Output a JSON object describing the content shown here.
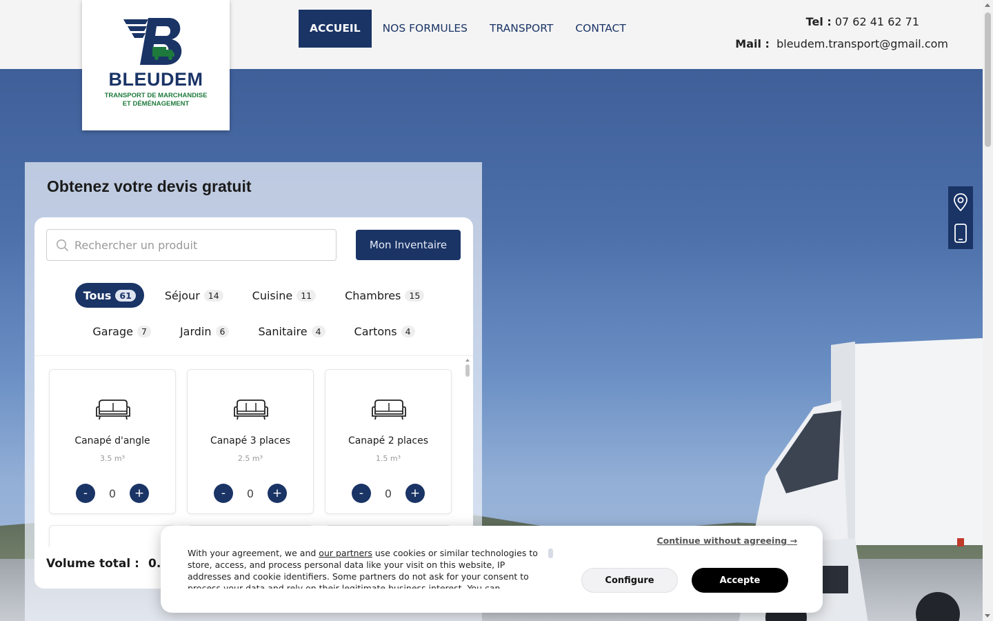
{
  "brand": {
    "name": "BLEUDEM",
    "tagline_line1": "TRANSPORT DE MARCHANDISE",
    "tagline_line2": "ET DÉMÉNAGEMENT",
    "primary_color": "#1a3466",
    "accent_color": "#1e7a3c"
  },
  "nav": {
    "items": [
      {
        "label": "ACCUEIL",
        "active": true
      },
      {
        "label": "NOS FORMULES",
        "active": false
      },
      {
        "label": "TRANSPORT",
        "active": false
      },
      {
        "label": "CONTACT",
        "active": false
      }
    ]
  },
  "contact": {
    "tel_label": "Tel :",
    "tel_value": "07 62 41 62 71",
    "mail_label": "Mail :",
    "mail_value": "bleudem.transport@gmail.com"
  },
  "side_icons": [
    "location-pin-icon",
    "smartphone-icon"
  ],
  "quote": {
    "title": "Obtenez votre devis gratuit",
    "search_placeholder": "Rechercher un produit",
    "inventory_button": "Mon Inventaire",
    "categories_row1": [
      {
        "label": "Tous",
        "count": "61",
        "active": true
      },
      {
        "label": "Séjour",
        "count": "14"
      },
      {
        "label": "Cuisine",
        "count": "11"
      },
      {
        "label": "Chambres",
        "count": "15"
      }
    ],
    "categories_row2": [
      {
        "label": "Garage",
        "count": "7"
      },
      {
        "label": "Jardin",
        "count": "6"
      },
      {
        "label": "Sanitaire",
        "count": "4"
      },
      {
        "label": "Cartons",
        "count": "4"
      }
    ],
    "products": [
      {
        "name": "Canapé d'angle",
        "volume": "3.5 m³",
        "qty": "0",
        "icon": "sofa-icon"
      },
      {
        "name": "Canapé 3 places",
        "volume": "2.5 m³",
        "qty": "0",
        "icon": "sofa-icon"
      },
      {
        "name": "Canapé 2 places",
        "volume": "1.5 m³",
        "qty": "0",
        "icon": "sofa-icon"
      }
    ],
    "minus_label": "-",
    "plus_label": "+",
    "volume_label": "Volume total :",
    "volume_value": "0."
  },
  "cookie": {
    "text_before_link": "With your agreement, we and ",
    "link_text": "our partners",
    "text_after_link": " use cookies or similar technologies to store, access, and process personal data like your visit on this website, IP addresses and cookie identifiers. Some partners do not ask for your consent to process your data and rely on their legitimate business interest. You can",
    "continue_label": "Continue without agreeing →",
    "configure_label": "Configure",
    "accept_label": "Accepte"
  }
}
